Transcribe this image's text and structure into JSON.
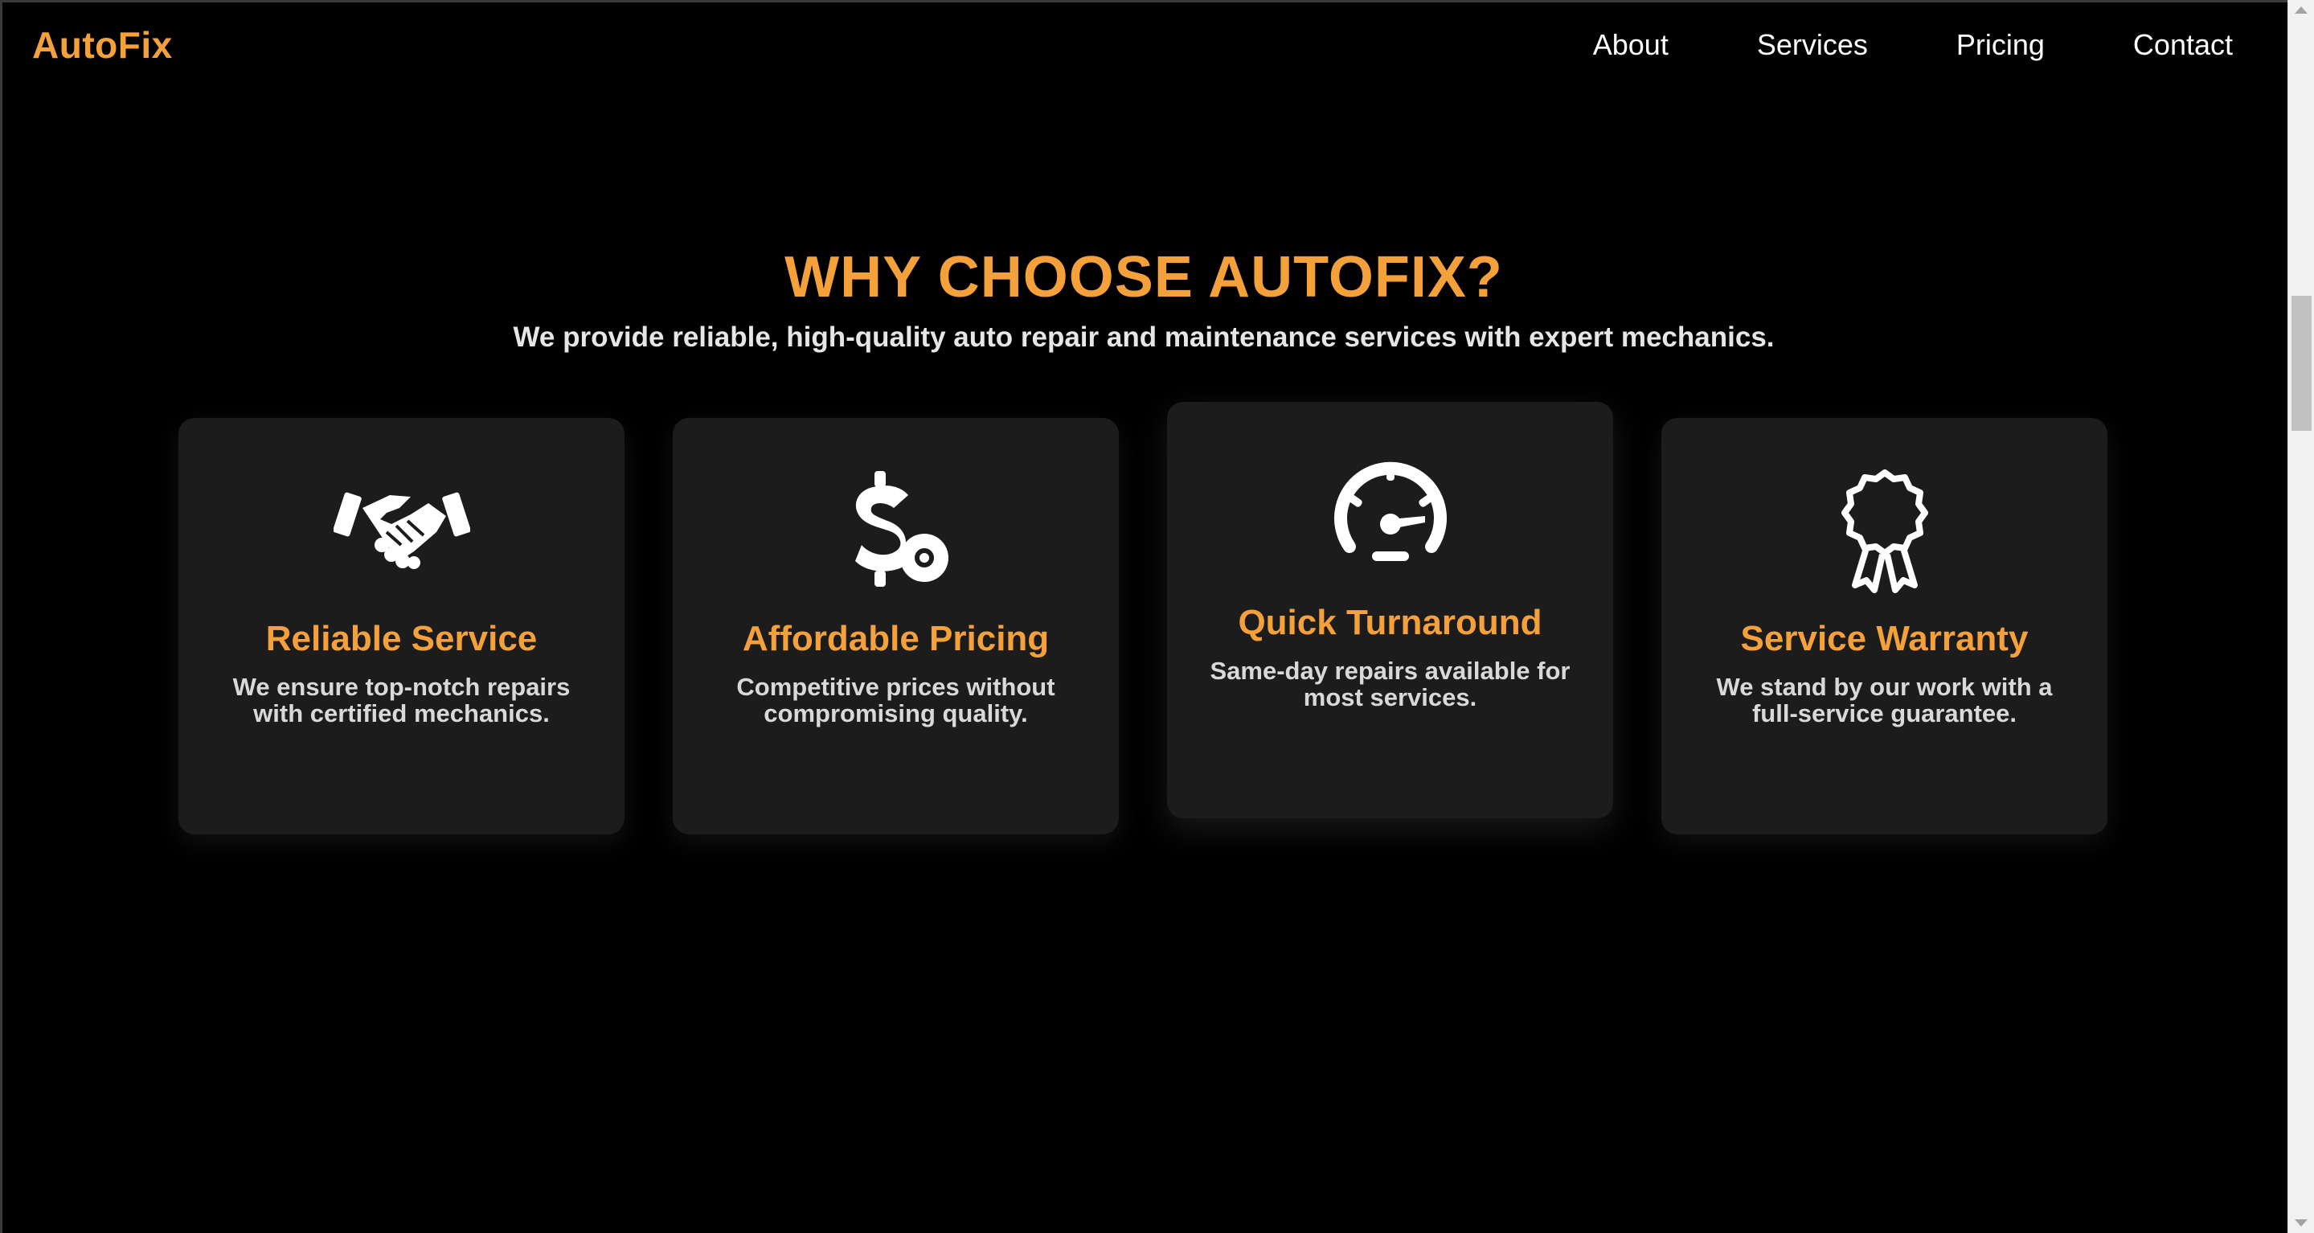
{
  "nav": {
    "brand": "AutoFix",
    "links": [
      "About",
      "Services",
      "Pricing",
      "Contact"
    ]
  },
  "hero": {
    "title": "WHY CHOOSE AUTOFIX?",
    "subtitle": "We provide reliable, high-quality auto repair and maintenance services with expert mechanics."
  },
  "features": [
    {
      "icon": "handshake-icon",
      "title": "Reliable Service",
      "description": "We ensure top-notch repairs with certified mechanics."
    },
    {
      "icon": "dollar-gear-icon",
      "title": "Affordable Pricing",
      "description": "Competitive prices without compromising quality."
    },
    {
      "icon": "speedometer-icon",
      "title": "Quick Turnaround",
      "description": "Same-day repairs available for most services."
    },
    {
      "icon": "award-ribbon-icon",
      "title": "Service Warranty",
      "description": "We stand by our work with a full-service guarantee."
    }
  ],
  "colors": {
    "accent": "#f5a13b",
    "background": "#000000",
    "card": "#1c1c1c"
  }
}
